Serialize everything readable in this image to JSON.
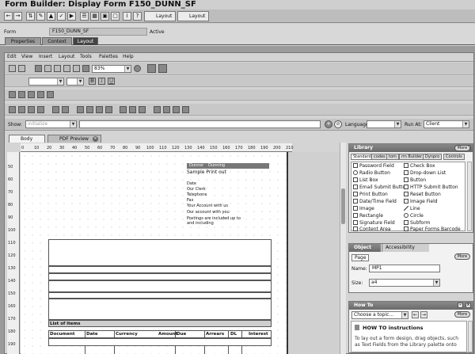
{
  "title": "Form Builder: Display Form F150_DUNN_SF",
  "toolbar": {
    "layout1": "Layout",
    "layout2": "Layout"
  },
  "form": {
    "label": "Form",
    "value": "F150_DUNN_SF",
    "status": "Active"
  },
  "tabs": [
    "Properties",
    "Context",
    "Layout"
  ],
  "menu": [
    "Edit",
    "View",
    "Insert",
    "Layout",
    "Tools",
    "Palettes",
    "Help"
  ],
  "zoom": "83%",
  "show": {
    "label": "Show:",
    "placeholder": "initialize",
    "language_label": "Language:",
    "runat_label": "Run At:",
    "runat_value": "Client"
  },
  "editor_tabs": [
    "Body Pages",
    "PDF Preview"
  ],
  "ruler_h": [
    "0",
    "10",
    "20",
    "30",
    "40",
    "50",
    "60",
    "70",
    "80",
    "90",
    "100",
    "110",
    "120",
    "130",
    "140",
    "150",
    "160",
    "170",
    "180",
    "190",
    "200",
    "210"
  ],
  "ruler_v": [
    "50",
    "60",
    "70",
    "80",
    "90",
    "100",
    "110",
    "120",
    "130",
    "140",
    "150",
    "160",
    "170",
    "180",
    "190",
    "200",
    "210",
    "220"
  ],
  "canvas": {
    "header_left": "Dunnsr",
    "header_right": "Dunning",
    "sample": "Sample Print out",
    "fields": [
      "Date",
      "Our Clerk",
      "Telephone",
      "Fax",
      "Your Account with us",
      "Our account with you",
      "Postings are included up to",
      "and including"
    ],
    "list_title": "List of items",
    "columns": [
      "Document",
      "Date",
      "Currency",
      "Amount",
      "Due",
      "Arrears",
      "DL",
      "Interest"
    ]
  },
  "library": {
    "title": "Library",
    "more": "More",
    "tabs": [
      "Standard",
      "codes",
      "tom",
      "rm Builder",
      "Dynpro",
      "Controls"
    ],
    "left": [
      "Password Field",
      "Radio Button",
      "List Box",
      "Email Submit Button",
      "Print Button",
      "Date/Time Field",
      "Image",
      "Rectangle",
      "Signature Field",
      "Content Area"
    ],
    "right": [
      "Check Box",
      "Drop-down List",
      "Button",
      "HTTP Submit Button",
      "Reset Button",
      "Image Field",
      "Line",
      "Circle",
      "Subform",
      "Paper Forms Barcode"
    ]
  },
  "object": {
    "title": "Object",
    "accessibility": "Accessibility",
    "more": "More",
    "page_tab": "Page",
    "name_label": "Name:",
    "name_value": "MP1",
    "size_label": "Size:",
    "size_value": "a4"
  },
  "howto": {
    "title": "How To",
    "more": "More",
    "select": "Choose a topic...",
    "heading": "HOW TO instructions",
    "text1": "To lay out a form design, drag objects, such",
    "text2": "as Text Fields from the Library palette onto"
  }
}
